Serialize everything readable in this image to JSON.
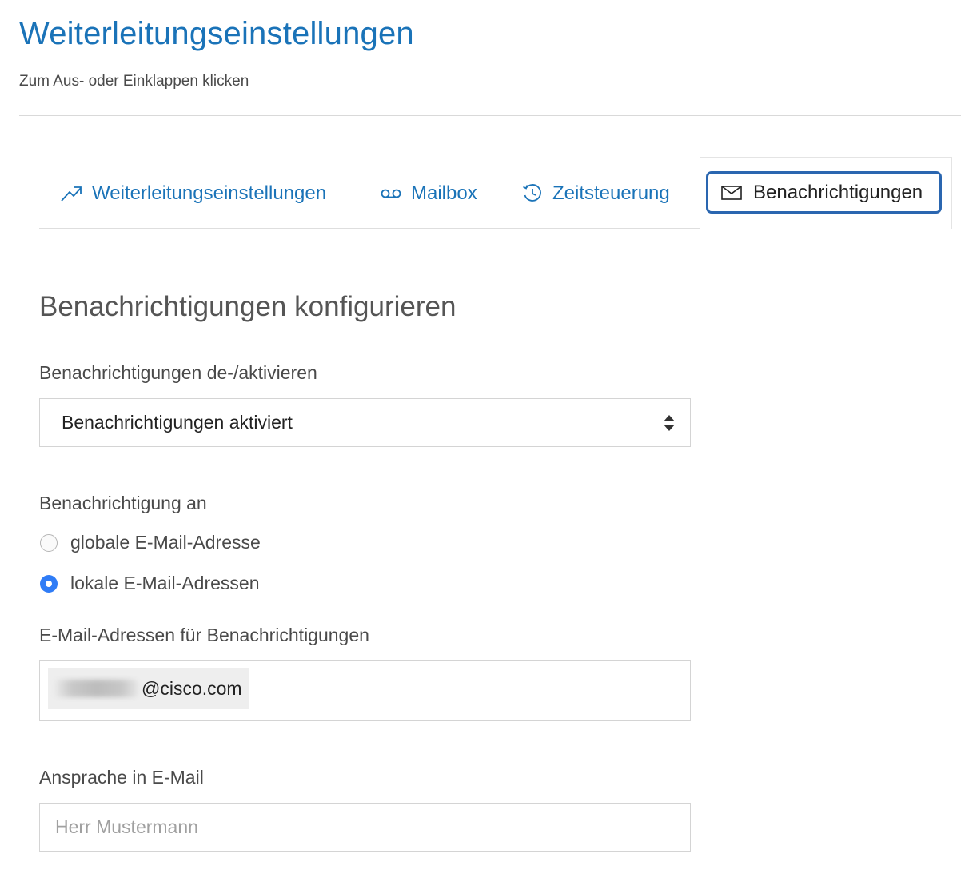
{
  "header": {
    "title": "Weiterleitungseinstellungen",
    "subtitle": "Zum Aus- oder Einklappen klicken"
  },
  "tabs": [
    {
      "label": "Weiterleitungseinstellungen",
      "icon": "arrow-up-right-icon",
      "active": false
    },
    {
      "label": "Mailbox",
      "icon": "voicemail-icon",
      "active": false
    },
    {
      "label": "Zeitsteuerung",
      "icon": "clock-icon",
      "active": false
    },
    {
      "label": "Benachrichtigungen",
      "icon": "envelope-icon",
      "active": true
    }
  ],
  "main": {
    "heading": "Benachrichtigungen konfigurieren",
    "toggle": {
      "label": "Benachrichtigungen de-/aktivieren",
      "selected": "Benachrichtigungen aktiviert"
    },
    "recipient": {
      "label": "Benachrichtigung an",
      "options": [
        {
          "label": "globale E-Mail-Adresse",
          "checked": false
        },
        {
          "label": "lokale E-Mail-Adressen",
          "checked": true
        }
      ]
    },
    "emails": {
      "label": "E-Mail-Adressen für Benachrichtigungen",
      "entries": [
        {
          "domain": "@cisco.com"
        }
      ]
    },
    "salutation": {
      "label": "Ansprache in E-Mail",
      "value": "",
      "placeholder": "Herr Mustermann"
    }
  },
  "colors": {
    "accent": "#1a73b8",
    "active_tab_border": "#2a66b0",
    "radio_checked": "#2f7cf6"
  }
}
